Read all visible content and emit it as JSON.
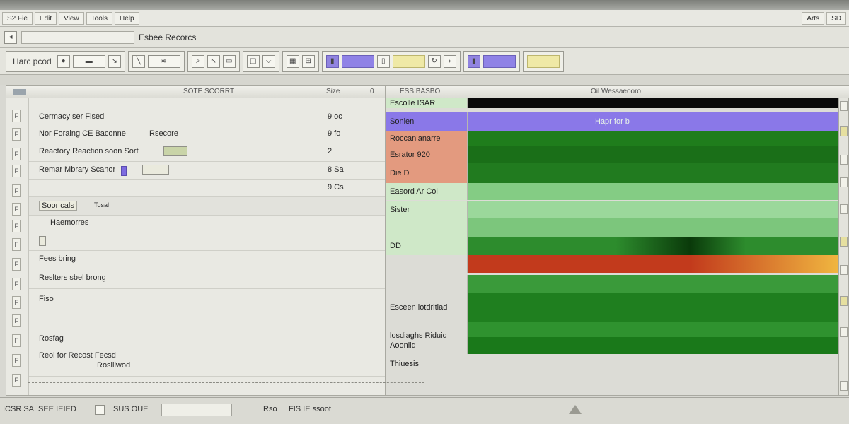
{
  "menubar": {
    "items": [
      "S2 Fie",
      "Edit",
      "View",
      "Tools",
      "Help"
    ],
    "right_items": [
      "Arts",
      "SD"
    ]
  },
  "addressbar": {
    "field_value": "",
    "label": "Esbee Recorcs"
  },
  "toolbar": {
    "first_label": "Harc pcod"
  },
  "left_pane": {
    "headers": {
      "name": "SOTE SCORRT",
      "size": "Size",
      "info": "0"
    },
    "rows": [
      {
        "label": "Cermacy ser Fised",
        "size": "9 oc"
      },
      {
        "label": "Nor Foraing CE Baconne",
        "extra": "Rsecore",
        "size": "9 fo"
      },
      {
        "label": "Reactory Reaction soon Sort",
        "size": "2"
      },
      {
        "label": "Remar Mbrary Scanor",
        "size": "8 Sa"
      },
      {
        "label": "",
        "size": "9 Cs"
      },
      {
        "label": "Soor cals",
        "extra": "Tosal"
      },
      {
        "label": "Haemorres",
        "extra": ""
      },
      {
        "label": ""
      },
      {
        "label": "Fees bring"
      },
      {
        "label": "Reslters sbel brong"
      },
      {
        "label": "Fiso"
      },
      {
        "label": ""
      },
      {
        "label": "Rosfag"
      },
      {
        "label": "Reol for Recost Fecsd",
        "extra": "Rosiliwod"
      }
    ]
  },
  "right_pane": {
    "headers": {
      "label_col": "ESS BASBO",
      "track_col": "Oil Wessaeooro"
    },
    "tracks": [
      {
        "label": "Escolle ISAR",
        "band": "",
        "color": "#0a0a0a"
      },
      {
        "label": "Sonlen",
        "band": "Hapr for b",
        "color": "#8a78e8"
      },
      {
        "label": "Roccanianarre",
        "band": "",
        "color": "#1f7d1c"
      },
      {
        "label": "Esrator 920",
        "band": "",
        "color": "#1a6f18"
      },
      {
        "label": "Die D",
        "band": "",
        "color": "#217b1f"
      },
      {
        "label": "Easord Ar Col",
        "band": "",
        "color": "#84cc84"
      },
      {
        "label": "Sister",
        "band": "",
        "color": "#9bd89b"
      },
      {
        "label": "",
        "band": "",
        "color": "#7cc67c"
      },
      {
        "label": "DD",
        "band": "",
        "color": "#2d8c2d"
      },
      {
        "label": "",
        "band": "",
        "color": "#c23a1c"
      },
      {
        "label": "",
        "band": "",
        "color": "#3a9a3a"
      },
      {
        "label": "Esceen lotdritiad losdiaghs Riduid Thiuesis",
        "band": "",
        "color": "#1f7f1f"
      },
      {
        "label": "",
        "band": "",
        "color": "#2f922f"
      },
      {
        "label": "Aoonlid",
        "band": "",
        "color": "#1a791a"
      }
    ]
  },
  "statusbar": {
    "text1": "ICSR SA",
    "text2": "SEE IEIED",
    "text3": "SUS OUE",
    "box_value": "",
    "text4": "Rso",
    "text5": "FIS IE ssoot"
  },
  "colors": {
    "accent_purple": "#8a78e8",
    "track_green": "#1f7d1c",
    "track_red": "#c23a1c",
    "track_orange": "#f0b640"
  }
}
